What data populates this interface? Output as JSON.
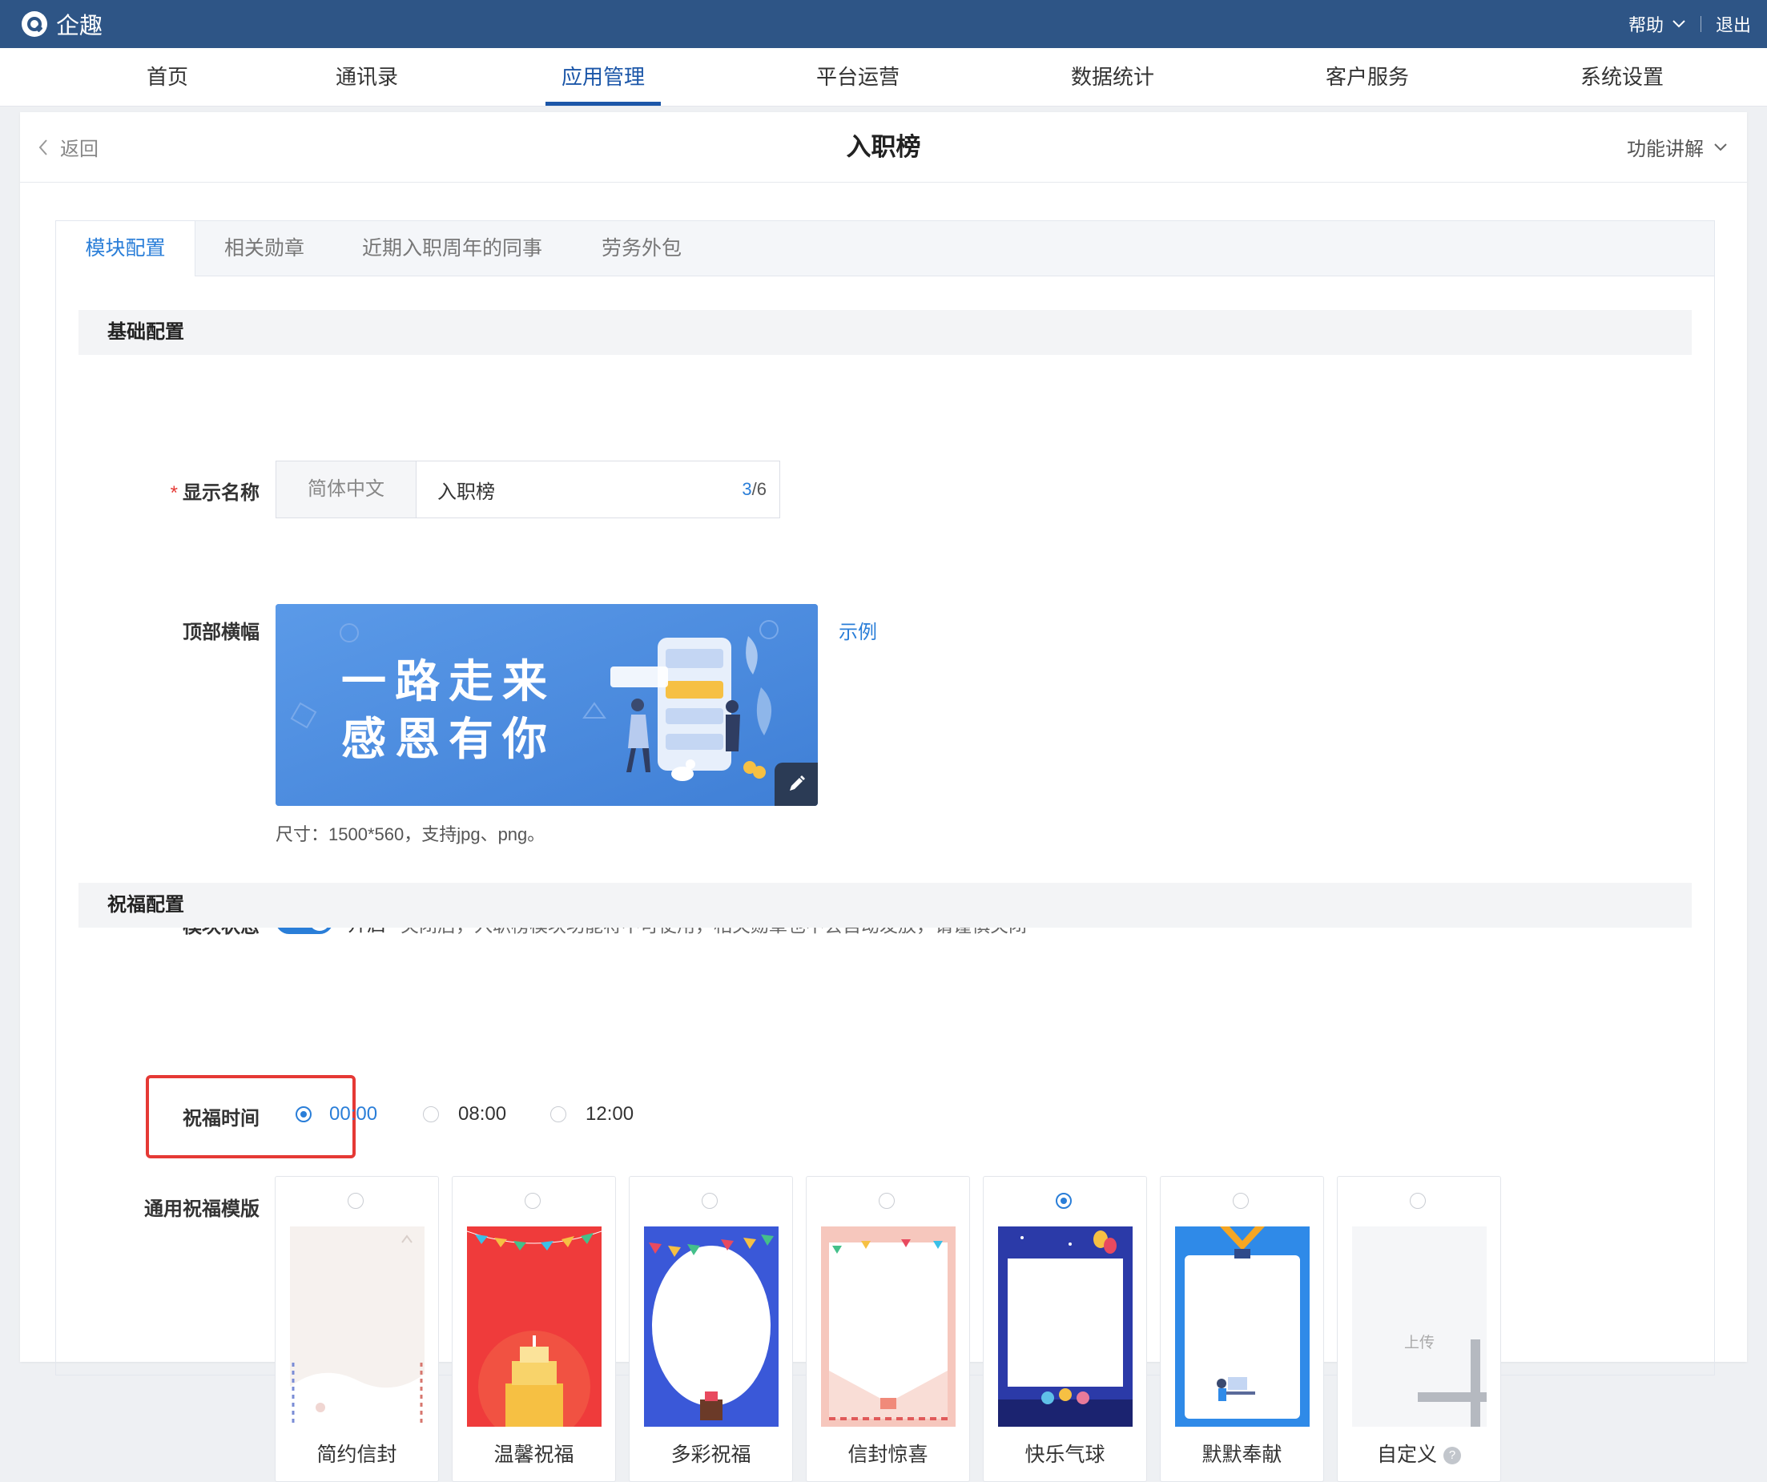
{
  "app": {
    "name": "企趣",
    "help_label": "帮助",
    "logout_label": "退出",
    "brand_color": "#2e5586",
    "accent_color": "#2a7ed8"
  },
  "nav": {
    "items": [
      {
        "label": "首页",
        "active": false
      },
      {
        "label": "通讯录",
        "active": false
      },
      {
        "label": "应用管理",
        "active": true
      },
      {
        "label": "平台运营",
        "active": false
      },
      {
        "label": "数据统计",
        "active": false
      },
      {
        "label": "客户服务",
        "active": false
      },
      {
        "label": "系统设置",
        "active": false
      }
    ]
  },
  "page": {
    "back_label": "返回",
    "title": "入职榜",
    "help_label": "功能讲解"
  },
  "tabs": [
    {
      "label": "模块配置",
      "active": true
    },
    {
      "label": "相关勋章",
      "active": false
    },
    {
      "label": "近期入职周年的同事",
      "active": false
    },
    {
      "label": "劳务外包",
      "active": false
    }
  ],
  "basic": {
    "section_title": "基础配置",
    "name_field": {
      "label": "显示名称",
      "lang": "简体中文",
      "value": "入职榜",
      "count_current": "3",
      "count_rest": "/6"
    },
    "banner": {
      "label": "顶部横幅",
      "line1": "一路走来",
      "line2": "感恩有你",
      "example_link": "示例",
      "hint": "尺寸：1500*560，支持jpg、png。"
    },
    "status": {
      "label": "模块状态",
      "state_label": "开启",
      "enabled": true,
      "description": "关闭后，入职榜模块功能将不可使用，相关勋章也不会自动发放，请谨慎关闭"
    }
  },
  "blessing": {
    "section_title": "祝福配置",
    "time": {
      "label": "祝福时间",
      "options": [
        {
          "label": "00:00",
          "selected": true
        },
        {
          "label": "08:00",
          "selected": false
        },
        {
          "label": "12:00",
          "selected": false
        }
      ]
    },
    "templates": {
      "label": "通用祝福模版",
      "items": [
        {
          "name": "简约信封",
          "selected": false
        },
        {
          "name": "温馨祝福",
          "selected": false
        },
        {
          "name": "多彩祝福",
          "selected": false
        },
        {
          "name": "信封惊喜",
          "selected": false
        },
        {
          "name": "快乐气球",
          "selected": true
        },
        {
          "name": "默默奉献",
          "selected": false
        },
        {
          "name": "自定义",
          "selected": false
        }
      ],
      "upload_label": "上传",
      "help_glyph": "?"
    }
  }
}
